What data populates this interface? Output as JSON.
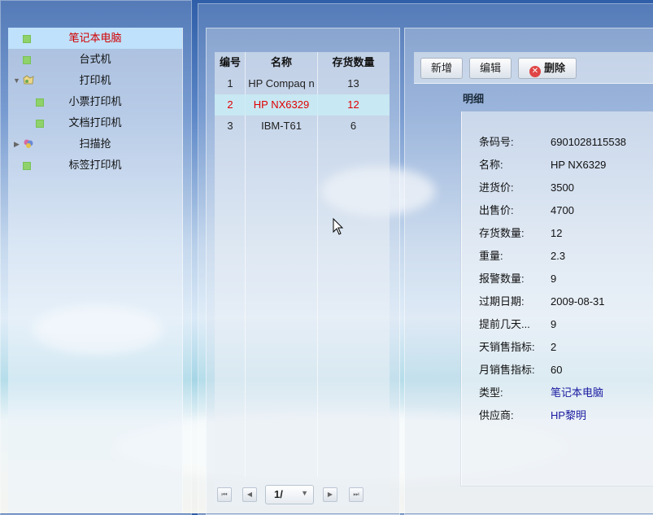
{
  "tree": {
    "items": [
      {
        "label": "笔记本电脑",
        "level": 0,
        "type": "leaf",
        "selected": true
      },
      {
        "label": "台式机",
        "level": 0,
        "type": "leaf"
      },
      {
        "label": "打印机",
        "level": 0,
        "type": "folder",
        "expanded": true
      },
      {
        "label": "小票打印机",
        "level": 1,
        "type": "leaf"
      },
      {
        "label": "文档打印机",
        "level": 1,
        "type": "leaf"
      },
      {
        "label": "扫描抢",
        "level": 0,
        "type": "folder",
        "expanded": false
      },
      {
        "label": "标签打印机",
        "level": 0,
        "type": "leaf"
      }
    ]
  },
  "list": {
    "headers": {
      "id": "编号",
      "name": "名称",
      "qty": "存货数量"
    },
    "rows": [
      {
        "id": "1",
        "name": "HP Compaq n",
        "qty": "13",
        "selected": false
      },
      {
        "id": "2",
        "name": "HP NX6329",
        "qty": "12",
        "selected": true
      },
      {
        "id": "3",
        "name": "IBM-T61",
        "qty": "6",
        "selected": false
      }
    ],
    "pager": {
      "page_text": "1/"
    }
  },
  "toolbar": {
    "add": "新增",
    "edit": "编辑",
    "delete": "删除"
  },
  "detail": {
    "title": "明细",
    "fields": [
      {
        "label": "条码号:",
        "value": "6901028115538"
      },
      {
        "label": "名称:",
        "value": "HP NX6329"
      },
      {
        "label": "进货价:",
        "value": "3500"
      },
      {
        "label": "出售价:",
        "value": "4700"
      },
      {
        "label": "存货数量:",
        "value": "12"
      },
      {
        "label": "重量:",
        "value": "2.3"
      },
      {
        "label": "报警数量:",
        "value": "9"
      },
      {
        "label": "过期日期:",
        "value": "2009-08-31"
      },
      {
        "label": "提前几天...",
        "value": "9"
      },
      {
        "label": "天销售指标:",
        "value": "2"
      },
      {
        "label": "月销售指标:",
        "value": "60"
      },
      {
        "label": "类型:",
        "value": "笔记本电脑",
        "link": true
      },
      {
        "label": "供应商:",
        "value": "HP黎明",
        "link": true
      }
    ]
  },
  "colors": {
    "selected_text": "#d10000",
    "link": "#1a1aa0",
    "selected_bg": "#bfe1fb"
  }
}
